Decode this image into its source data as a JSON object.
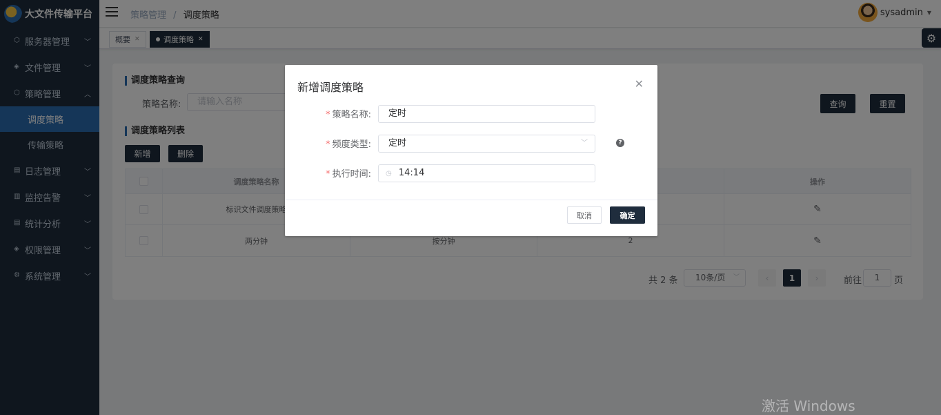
{
  "app": {
    "title": "大文件传输平台"
  },
  "sidebar": {
    "items": [
      {
        "label": "服务器管理",
        "icon": "server-icon"
      },
      {
        "label": "文件管理",
        "icon": "file-icon"
      },
      {
        "label": "策略管理",
        "icon": "strategy-icon",
        "expanded": true
      },
      {
        "label": "日志管理",
        "icon": "log-icon"
      },
      {
        "label": "监控告警",
        "icon": "monitor-icon"
      },
      {
        "label": "统计分析",
        "icon": "stats-icon"
      },
      {
        "label": "权限管理",
        "icon": "permission-icon"
      },
      {
        "label": "系统管理",
        "icon": "system-icon"
      }
    ],
    "sub_items": [
      {
        "label": "调度策略",
        "active": true
      },
      {
        "label": "传输策略",
        "active": false
      }
    ]
  },
  "header": {
    "breadcrumb": [
      "策略管理",
      "调度策略"
    ],
    "separator": "/",
    "username": "sysadmin"
  },
  "tags": [
    {
      "label": "概要",
      "active": false
    },
    {
      "label": "调度策略",
      "active": true
    }
  ],
  "query": {
    "section_title": "调度策略查询",
    "name_label": "策略名称:",
    "name_placeholder": "请输入名称",
    "search_label": "查询",
    "reset_label": "重置"
  },
  "list": {
    "section_title": "调度策略列表",
    "add_label": "新增",
    "delete_label": "删除",
    "columns": [
      "调度策略名称",
      "操作"
    ],
    "rows": [
      {
        "name": "标识文件调度策略",
        "type": "",
        "value": ""
      },
      {
        "name": "两分钟",
        "type": "按分钟",
        "value": "2"
      }
    ]
  },
  "pagination": {
    "total": "共 2 条",
    "page_size": "10条/页",
    "current_page": "1",
    "goto_label": "前往",
    "goto_value": "1",
    "page_suffix": "页"
  },
  "dialog": {
    "title": "新增调度策略",
    "fields": [
      {
        "label": "策略名称:",
        "value": "定时"
      },
      {
        "label": "频度类型:",
        "value": "定时"
      },
      {
        "label": "执行时间:",
        "value": "14:14"
      }
    ],
    "required_mark": "*",
    "cancel_label": "取消",
    "ok_label": "确定"
  },
  "watermark": "激活 Windows",
  "colors": {
    "sidebar_bg": "#1f2d3d",
    "accent": "#2b6cb0",
    "required": "#f56c6c"
  }
}
